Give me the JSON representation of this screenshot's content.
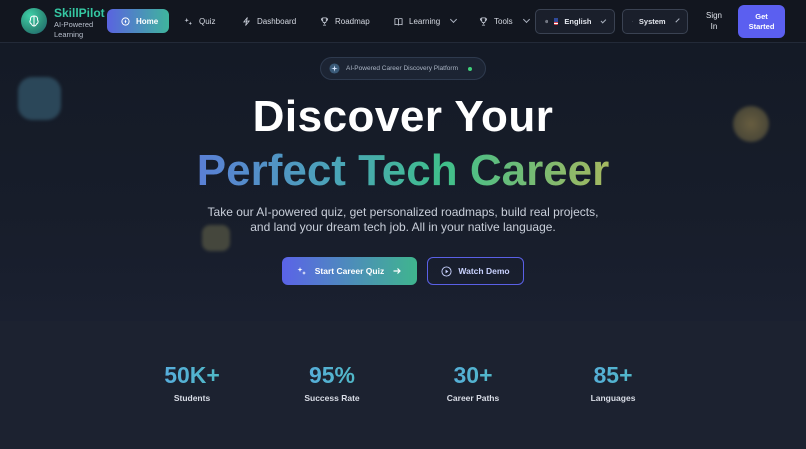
{
  "nav": {
    "brand_name": "SkillPilot",
    "brand_sub_1": "AI-Powered",
    "brand_sub_2": "Learning",
    "items": [
      {
        "label": "Home",
        "icon": "compass-icon"
      },
      {
        "label": "Quiz",
        "icon": "sparkle-icon"
      },
      {
        "label": "Dashboard",
        "icon": "bolt-icon"
      },
      {
        "label": "Roadmap",
        "icon": "trophy-icon"
      },
      {
        "label": "Learning",
        "icon": "book-icon"
      },
      {
        "label": "Tools",
        "icon": "trophy-icon"
      }
    ],
    "language": "English",
    "theme": "System",
    "signin_1": "Sign",
    "signin_2": "In",
    "cta_1": "Get",
    "cta_2": "Started"
  },
  "hero": {
    "badge": "AI-Powered Career Discovery Platform",
    "title_line1": "Discover Your",
    "title_line2": "Perfect Tech Career",
    "lead_line1": "Take our AI-powered quiz, get personalized roadmaps, build real projects,",
    "lead_line2": "and land your dream tech job. All in your native language.",
    "primary_cta": "Start Career Quiz",
    "secondary_cta": "Watch Demo"
  },
  "stats": [
    {
      "value": "50K+",
      "label": "Students"
    },
    {
      "value": "95%",
      "label": "Success Rate"
    },
    {
      "value": "30+",
      "label": "Career Paths"
    },
    {
      "value": "85+",
      "label": "Languages"
    }
  ],
  "colors": {
    "accent": "#5b5ff0",
    "brand_green": "#35c9a4",
    "background": "#0f1420"
  }
}
